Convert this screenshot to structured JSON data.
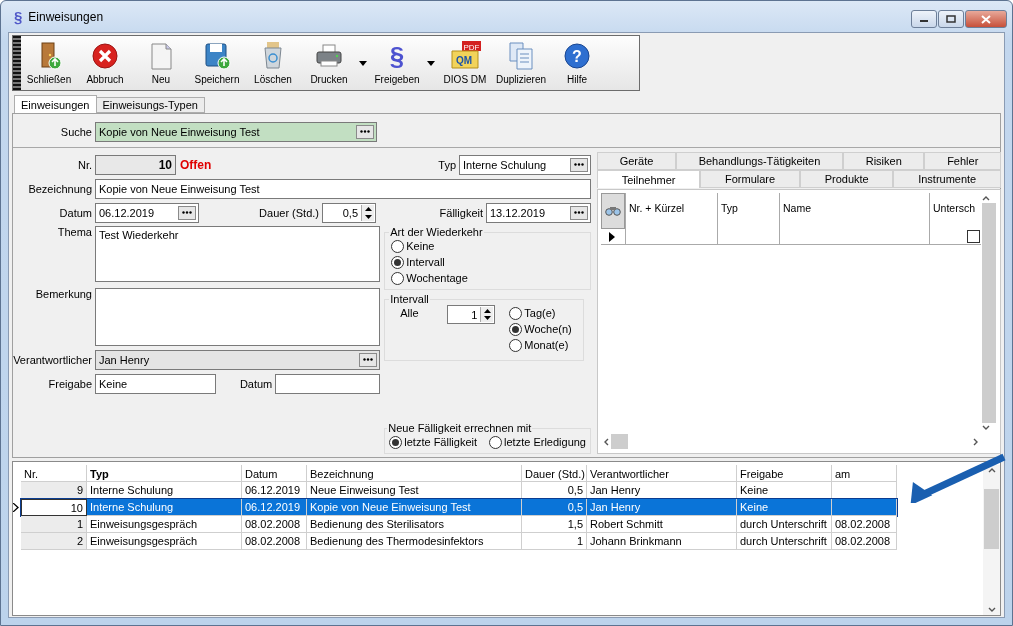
{
  "window": {
    "title": "Einweisungen",
    "icon_glyph": "§"
  },
  "toolbar": [
    {
      "label": "Schließen",
      "kind": "door",
      "dropdown": false
    },
    {
      "label": "Abbruch",
      "kind": "cancel",
      "dropdown": false
    },
    {
      "label": "Neu",
      "kind": "page",
      "dropdown": false
    },
    {
      "label": "Speichern",
      "kind": "save",
      "dropdown": false
    },
    {
      "label": "Löschen",
      "kind": "trash",
      "dropdown": false
    },
    {
      "label": "Drucken",
      "kind": "printer",
      "dropdown": true
    },
    {
      "label": "Freigeben",
      "kind": "glyph",
      "glyph": "§",
      "dropdown": true
    },
    {
      "label": "DIOS DM",
      "kind": "qm",
      "glyph": "QM",
      "tag": "PDF",
      "dropdown": false
    },
    {
      "label": "Duplizieren",
      "kind": "copy",
      "dropdown": false
    },
    {
      "label": "Hilfe",
      "kind": "help",
      "glyph": "?",
      "dropdown": false
    }
  ],
  "tabs": [
    {
      "label": "Einweisungen",
      "selected": true
    },
    {
      "label": "Einweisungs-Typen",
      "selected": false
    }
  ],
  "search": {
    "label": "Suche",
    "value": "Kopie von Neue Einweisung Test"
  },
  "form": {
    "nr": {
      "label": "Nr.",
      "value": "10",
      "status": "Offen"
    },
    "typ": {
      "label": "Typ",
      "value": "Interne Schulung"
    },
    "bezeichnung": {
      "label": "Bezeichnung",
      "value": "Kopie von Neue Einweisung Test"
    },
    "datum": {
      "label": "Datum",
      "value": "06.12.2019"
    },
    "dauer": {
      "label": "Dauer (Std.)",
      "value": "0,5"
    },
    "faelligkeit": {
      "label": "Fälligkeit",
      "value": "13.12.2019"
    },
    "thema": {
      "label": "Thema",
      "value": "Test Wiederkehr"
    },
    "bemerkung": {
      "label": "Bemerkung"
    },
    "verantwortlicher": {
      "label": "Verantwortlicher",
      "value": "Jan Henry"
    },
    "freigabe": {
      "label": "Freigabe",
      "value": "Keine"
    },
    "freigabe_datum": {
      "label": "Datum"
    }
  },
  "recurrence": {
    "title": "Art der Wiederkehr",
    "options": [
      {
        "label": "Keine",
        "selected": false
      },
      {
        "label": "Intervall",
        "selected": true
      },
      {
        "label": "Wochentage",
        "selected": false
      }
    ]
  },
  "interval": {
    "title": "Intervall",
    "every_label": "Alle",
    "count": "1",
    "units": [
      {
        "label": "Tag(e)",
        "selected": false
      },
      {
        "label": "Woche(n)",
        "selected": true
      },
      {
        "label": "Monat(e)",
        "selected": false
      }
    ]
  },
  "due_basis": {
    "title": "Neue Fälligkeit errechnen mit",
    "options": [
      {
        "label": "letzte Fälligkeit",
        "selected": true
      },
      {
        "label": "letzte Erledigung",
        "selected": false
      }
    ]
  },
  "detail_tabs": [
    [
      {
        "label": "Geräte",
        "selected": false
      },
      {
        "label": "Behandlungs-Tätigkeiten",
        "selected": false
      },
      {
        "label": "Risiken",
        "selected": false
      },
      {
        "label": "Fehler",
        "selected": false
      }
    ],
    [
      {
        "label": "Teilnehmer",
        "selected": true
      },
      {
        "label": "Formulare",
        "selected": false
      },
      {
        "label": "Produkte",
        "selected": false
      },
      {
        "label": "Instrumente",
        "selected": false
      }
    ]
  ],
  "participants": {
    "columns": [
      "Nr. + Kürzel",
      "Typ",
      "Name",
      "Untersch"
    ],
    "new_row": {
      "checked": false
    }
  },
  "grid": {
    "columns": [
      "Nr.",
      "Typ",
      "Datum",
      "Bezeichnung",
      "Dauer (Std.)",
      "Verantwortlicher",
      "Freigabe",
      "am"
    ],
    "rows": [
      {
        "selected": false,
        "cells": [
          "9",
          "Interne Schulung",
          "06.12.2019",
          "Neue Einweisung Test",
          "0,5",
          "Jan Henry",
          "Keine",
          ""
        ]
      },
      {
        "selected": true,
        "cells": [
          "10",
          "Interne Schulung",
          "06.12.2019",
          "Kopie von Neue Einweisung Test",
          "0,5",
          "Jan Henry",
          "Keine",
          ""
        ]
      },
      {
        "selected": false,
        "cells": [
          "1",
          "Einweisungsgespräch",
          "08.02.2008",
          "Bedienung des Sterilisators",
          "1,5",
          "Robert Schmitt",
          "durch Unterschrift",
          "08.02.2008"
        ]
      },
      {
        "selected": false,
        "cells": [
          "2",
          "Einweisungsgespräch",
          "08.02.2008",
          "Bedienung des Thermodesinfektors",
          "1",
          "Johann Brinkmann",
          "durch Unterschrift",
          "08.02.2008"
        ]
      }
    ]
  }
}
